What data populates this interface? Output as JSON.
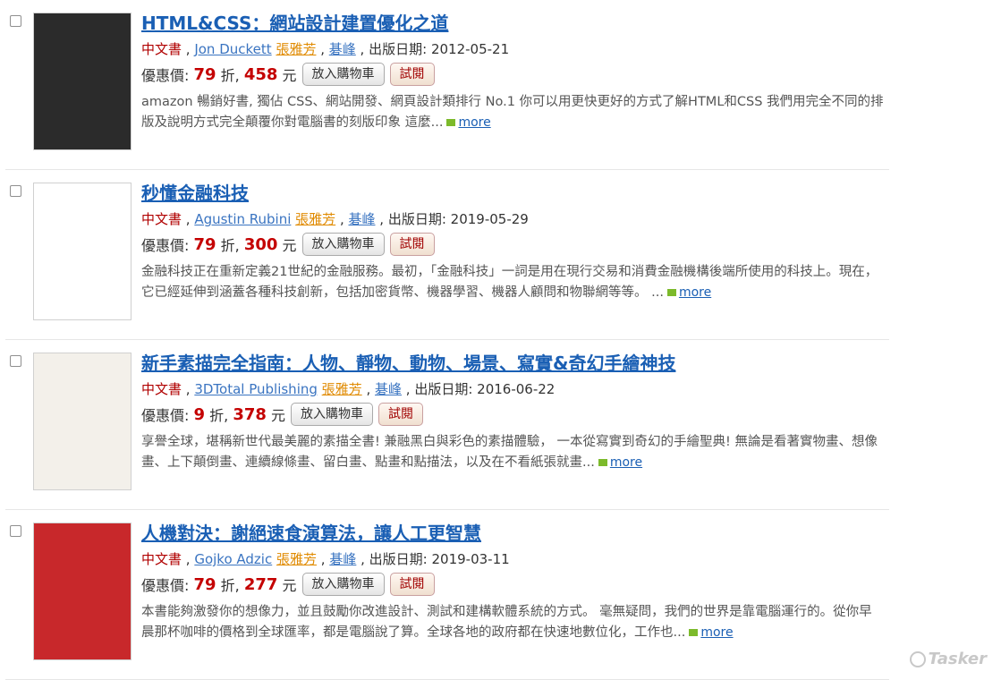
{
  "labels": {
    "price_prefix": "優惠價:",
    "discount_unit": "折,",
    "currency": "元",
    "date_prefix": "出版日期:",
    "cart_button": "放入購物車",
    "preview_button": "試閱",
    "more": "more"
  },
  "watermark": "Tasker",
  "books": [
    {
      "title": "HTML&CSS：網站設計建置優化之道",
      "category": "中文書",
      "author": "Jon Duckett",
      "translator": "張雅芳",
      "publisher": "碁峰",
      "date": "2012-05-21",
      "discount": "79",
      "price": "458",
      "description": "amazon 暢銷好書, 獨佔 CSS、網站開發、網頁設計類排行 No.1 你可以用更快更好的方式了解HTML和CSS 我們用完全不同的排版及說明方式完全顛覆你對電腦書的刻版印象 這麼...",
      "cover_color": "#2b2b2b"
    },
    {
      "title": "秒懂金融科技",
      "category": "中文書",
      "author": "Agustin Rubini",
      "translator": "張雅芳",
      "publisher": "碁峰",
      "date": "2019-05-29",
      "discount": "79",
      "price": "300",
      "description": "金融科技正在重新定義21世紀的金融服務。最初，「金融科技」一詞是用在現行交易和消費金融機構後端所使用的科技上。現在，它已經延伸到涵蓋各種科技創新，包括加密貨幣、機器學習、機器人顧問和物聯網等等。 ...",
      "cover_color": "#ffffff"
    },
    {
      "title": "新手素描完全指南：人物、靜物、動物、場景、寫實&奇幻手繪神技",
      "category": "中文書",
      "author": "3DTotal Publishing",
      "translator": "張雅芳",
      "publisher": "碁峰",
      "date": "2016-06-22",
      "discount": "9",
      "price": "378",
      "description": "享譽全球，堪稱新世代最美麗的素描全書! 兼融黑白與彩色的素描體驗， 一本從寫實到奇幻的手繪聖典! 無論是看著實物畫、想像畫、上下顛倒畫、連續線條畫、留白畫、點畫和點描法，以及在不看紙張就畫...",
      "cover_color": "#f3f0ea"
    },
    {
      "title": "人機對決：謝絕速食演算法，讓人工更智慧",
      "category": "中文書",
      "author": "Gojko Adzic",
      "translator": "張雅芳",
      "publisher": "碁峰",
      "date": "2019-03-11",
      "discount": "79",
      "price": "277",
      "description": "本書能夠激發你的想像力，並且鼓勵你改進設計、測試和建構軟體系統的方式。 毫無疑問，我們的世界是靠電腦運行的。從你早晨那杯咖啡的價格到全球匯率，都是電腦說了算。全球各地的政府都在快速地數位化，工作也...",
      "cover_color": "#c8282b"
    }
  ]
}
